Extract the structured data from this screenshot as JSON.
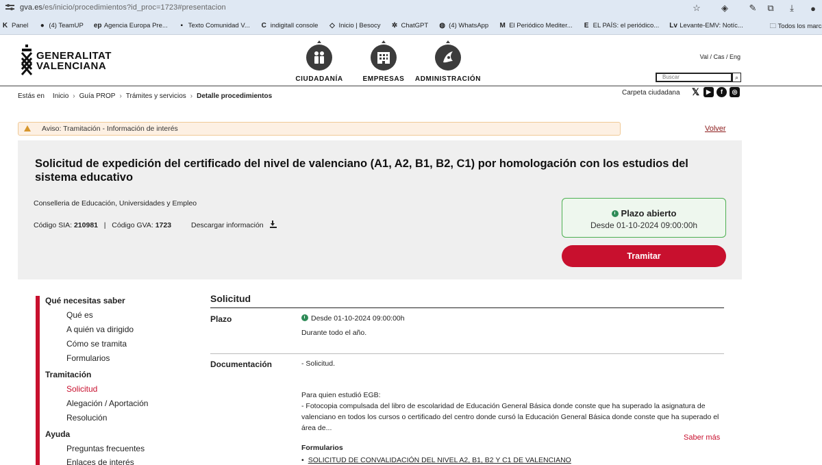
{
  "browser": {
    "url_host": "gva.es",
    "url_path": "/es/inicio/procedimientos?id_proc=1723#presentacion",
    "bookmarks": [
      {
        "icon": "K",
        "label": "Panel"
      },
      {
        "icon": "●",
        "label": "(4) TeamUP"
      },
      {
        "icon": "ep",
        "label": "Agencia Europa Pre..."
      },
      {
        "icon": "▪",
        "label": "Texto Comunidad V..."
      },
      {
        "icon": "C",
        "label": "indigitall console"
      },
      {
        "icon": "◇",
        "label": "Inicio | Besocy"
      },
      {
        "icon": "✲",
        "label": "ChatGPT"
      },
      {
        "icon": "◍",
        "label": "(4) WhatsApp"
      },
      {
        "icon": "M",
        "label": "El Periódico Mediter..."
      },
      {
        "icon": "E",
        "label": "EL PAÍS: el periódico..."
      },
      {
        "icon": "Lv",
        "label": "Levante-EMV: Notíc..."
      }
    ],
    "bookmarks_folder": "Todos los marcad"
  },
  "header": {
    "logo_line1": "GENERALITAT",
    "logo_line2": "VALENCIANA",
    "categories": [
      {
        "label": "CIUDADANÍA"
      },
      {
        "label": "EMPRESAS"
      },
      {
        "label": "ADMINISTRACIÓN"
      }
    ],
    "lang": "Val / Cas / Eng",
    "search_placeholder": "Buscar"
  },
  "breadcrumb": {
    "prefix": "Estás en",
    "items": [
      "Inicio",
      "Guía PROP",
      "Trámites y servicios",
      "Detalle procedimientos"
    ]
  },
  "carpeta": "Carpeta ciudadana",
  "alert": {
    "text": "Aviso: Tramitación - Información de interés"
  },
  "volver": "Volver",
  "procedure": {
    "title": "Solicitud de expedición del certificado del nivel de valenciano (A1, A2, B1, B2, C1) por homologación con los estudios del sistema educativo",
    "conselleria": "Conselleria de Educación, Universidades y Empleo",
    "sia_label": "Código SIA:",
    "sia_value": "210981",
    "gva_label": "Código GVA:",
    "gva_value": "1723",
    "download_label": "Descargar información",
    "plazo_status": "Plazo abierto",
    "plazo_date": "Desde 01-10-2024 09:00:00h",
    "tramitar": "Tramitar"
  },
  "nav": {
    "groups": [
      {
        "heading": "Qué necesitas saber",
        "items": [
          "Qué es",
          "A quién va dirigido",
          "Cómo se tramita",
          "Formularios"
        ]
      },
      {
        "heading": "Tramitación",
        "items": [
          "Solicitud",
          "Alegación / Aportación",
          "Resolución"
        ]
      },
      {
        "heading": "Ayuda",
        "items": [
          "Preguntas frecuentes",
          "Enlaces de interés"
        ]
      }
    ],
    "active": "Solicitud"
  },
  "content": {
    "section_title": "Solicitud",
    "plazo_label": "Plazo",
    "plazo_date": "Desde 01-10-2024 09:00:00h",
    "plazo_note": "Durante todo el año.",
    "doc_label": "Documentación",
    "doc_line1": "- Solicitud.",
    "doc_egb_intro": "Para quien estudió EGB:",
    "doc_egb_text": "- Fotocopia compulsada del libro de escolaridad de Educación General Básica donde conste que ha superado la asignatura de valenciano en todos los cursos o certificado del centro donde cursó la Educación General Básica donde conste que ha superado el área de...",
    "saber_mas": "Saber más",
    "formularios_label": "Formularios",
    "form_link": "SOLICITUD DE CONVALIDACIÓN DEL NIVEL A2, B1, B2 Y C1 DE VALENCIANO"
  }
}
